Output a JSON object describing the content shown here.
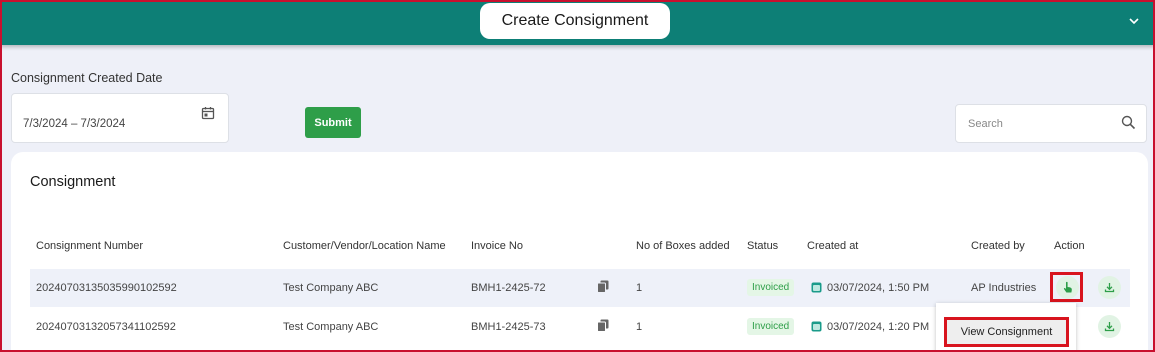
{
  "header": {
    "create_button": "Create Consignment",
    "expand_icon": "chevron-down-icon"
  },
  "filters": {
    "date_label": "Consignment Created Date",
    "date_range": "7/3/2024 – 7/3/2024",
    "calendar_icon": "calendar-icon",
    "submit_label": "Submit",
    "search_placeholder": "Search",
    "search_icon": "search-icon"
  },
  "table": {
    "title": "Consignment",
    "columns": [
      "Consignment Number",
      "Customer/Vendor/Location Name",
      "Invoice No",
      "No of Boxes added",
      "Status",
      "Created at",
      "Created by",
      "Action"
    ],
    "rows": [
      {
        "consignment_number": "20240703135035990102592",
        "customer": "Test Company ABC",
        "invoice_no": "BMH1-2425-72",
        "boxes": "1",
        "status": "Invoiced",
        "created_at": "03/07/2024, 1:50 PM",
        "created_by": "AP Industries"
      },
      {
        "consignment_number": "20240703132057341102592",
        "customer": "Test Company ABC",
        "invoice_no": "BMH1-2425-73",
        "boxes": "1",
        "status": "Invoiced",
        "created_at": "03/07/2024, 1:20 PM",
        "created_by": ""
      }
    ]
  },
  "action_menu": {
    "view_consignment": "View Consignment"
  },
  "colors": {
    "topbar": "#0d7f76",
    "submit": "#2e9e49",
    "highlight": "#d8141e",
    "badge_bg": "#e4f6e6",
    "badge_text": "#2e9e49"
  }
}
